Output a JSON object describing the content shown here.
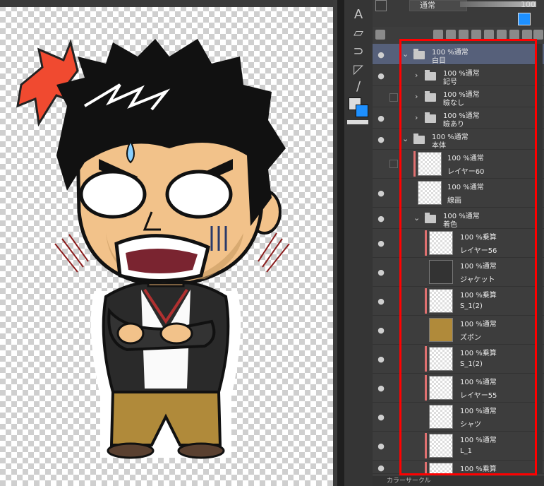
{
  "panel": {
    "blend_mode": "通常",
    "opacity": "100"
  },
  "layers": [
    {
      "mode": "100 %通常",
      "name": "白目",
      "type": "folder",
      "selected": true
    },
    {
      "mode": "100 %通常",
      "name": "記号",
      "type": "folder"
    },
    {
      "mode": "100 %通常",
      "name": "瞼なし",
      "type": "folder"
    },
    {
      "mode": "100 %通常",
      "name": "瞼あり",
      "type": "folder"
    },
    {
      "mode": "100 %通常",
      "name": "本体",
      "type": "folder"
    },
    {
      "mode": "100 %通常",
      "name": "レイヤー60",
      "type": "layer"
    },
    {
      "mode": "100 %通常",
      "name": "線画",
      "type": "layer"
    },
    {
      "mode": "100 %通常",
      "name": "着色",
      "type": "folder"
    },
    {
      "mode": "100 %乗算",
      "name": "レイヤー56",
      "type": "layer"
    },
    {
      "mode": "100 %通常",
      "name": "ジャケット",
      "type": "layer"
    },
    {
      "mode": "100 %乗算",
      "name": "S_1(2)",
      "type": "layer"
    },
    {
      "mode": "100 %通常",
      "name": "ズボン",
      "type": "layer"
    },
    {
      "mode": "100 %乗算",
      "name": "S_1(2)",
      "type": "layer"
    },
    {
      "mode": "100 %通常",
      "name": "レイヤー55",
      "type": "layer"
    },
    {
      "mode": "100 %通常",
      "name": "シャツ",
      "type": "layer"
    },
    {
      "mode": "100 %通常",
      "name": "L_1",
      "type": "layer"
    },
    {
      "mode": "100 %乗算",
      "name": "",
      "type": "layer"
    }
  ],
  "statusbar": {
    "label": "カラーサークル"
  },
  "icons": [
    "eye-icon",
    "folder-icon",
    "chevron-icon",
    "lock-icon"
  ],
  "colors": {
    "highlight": "#ff0000",
    "selected_row": "#56607a",
    "accent_blue": "#1e90ff"
  }
}
